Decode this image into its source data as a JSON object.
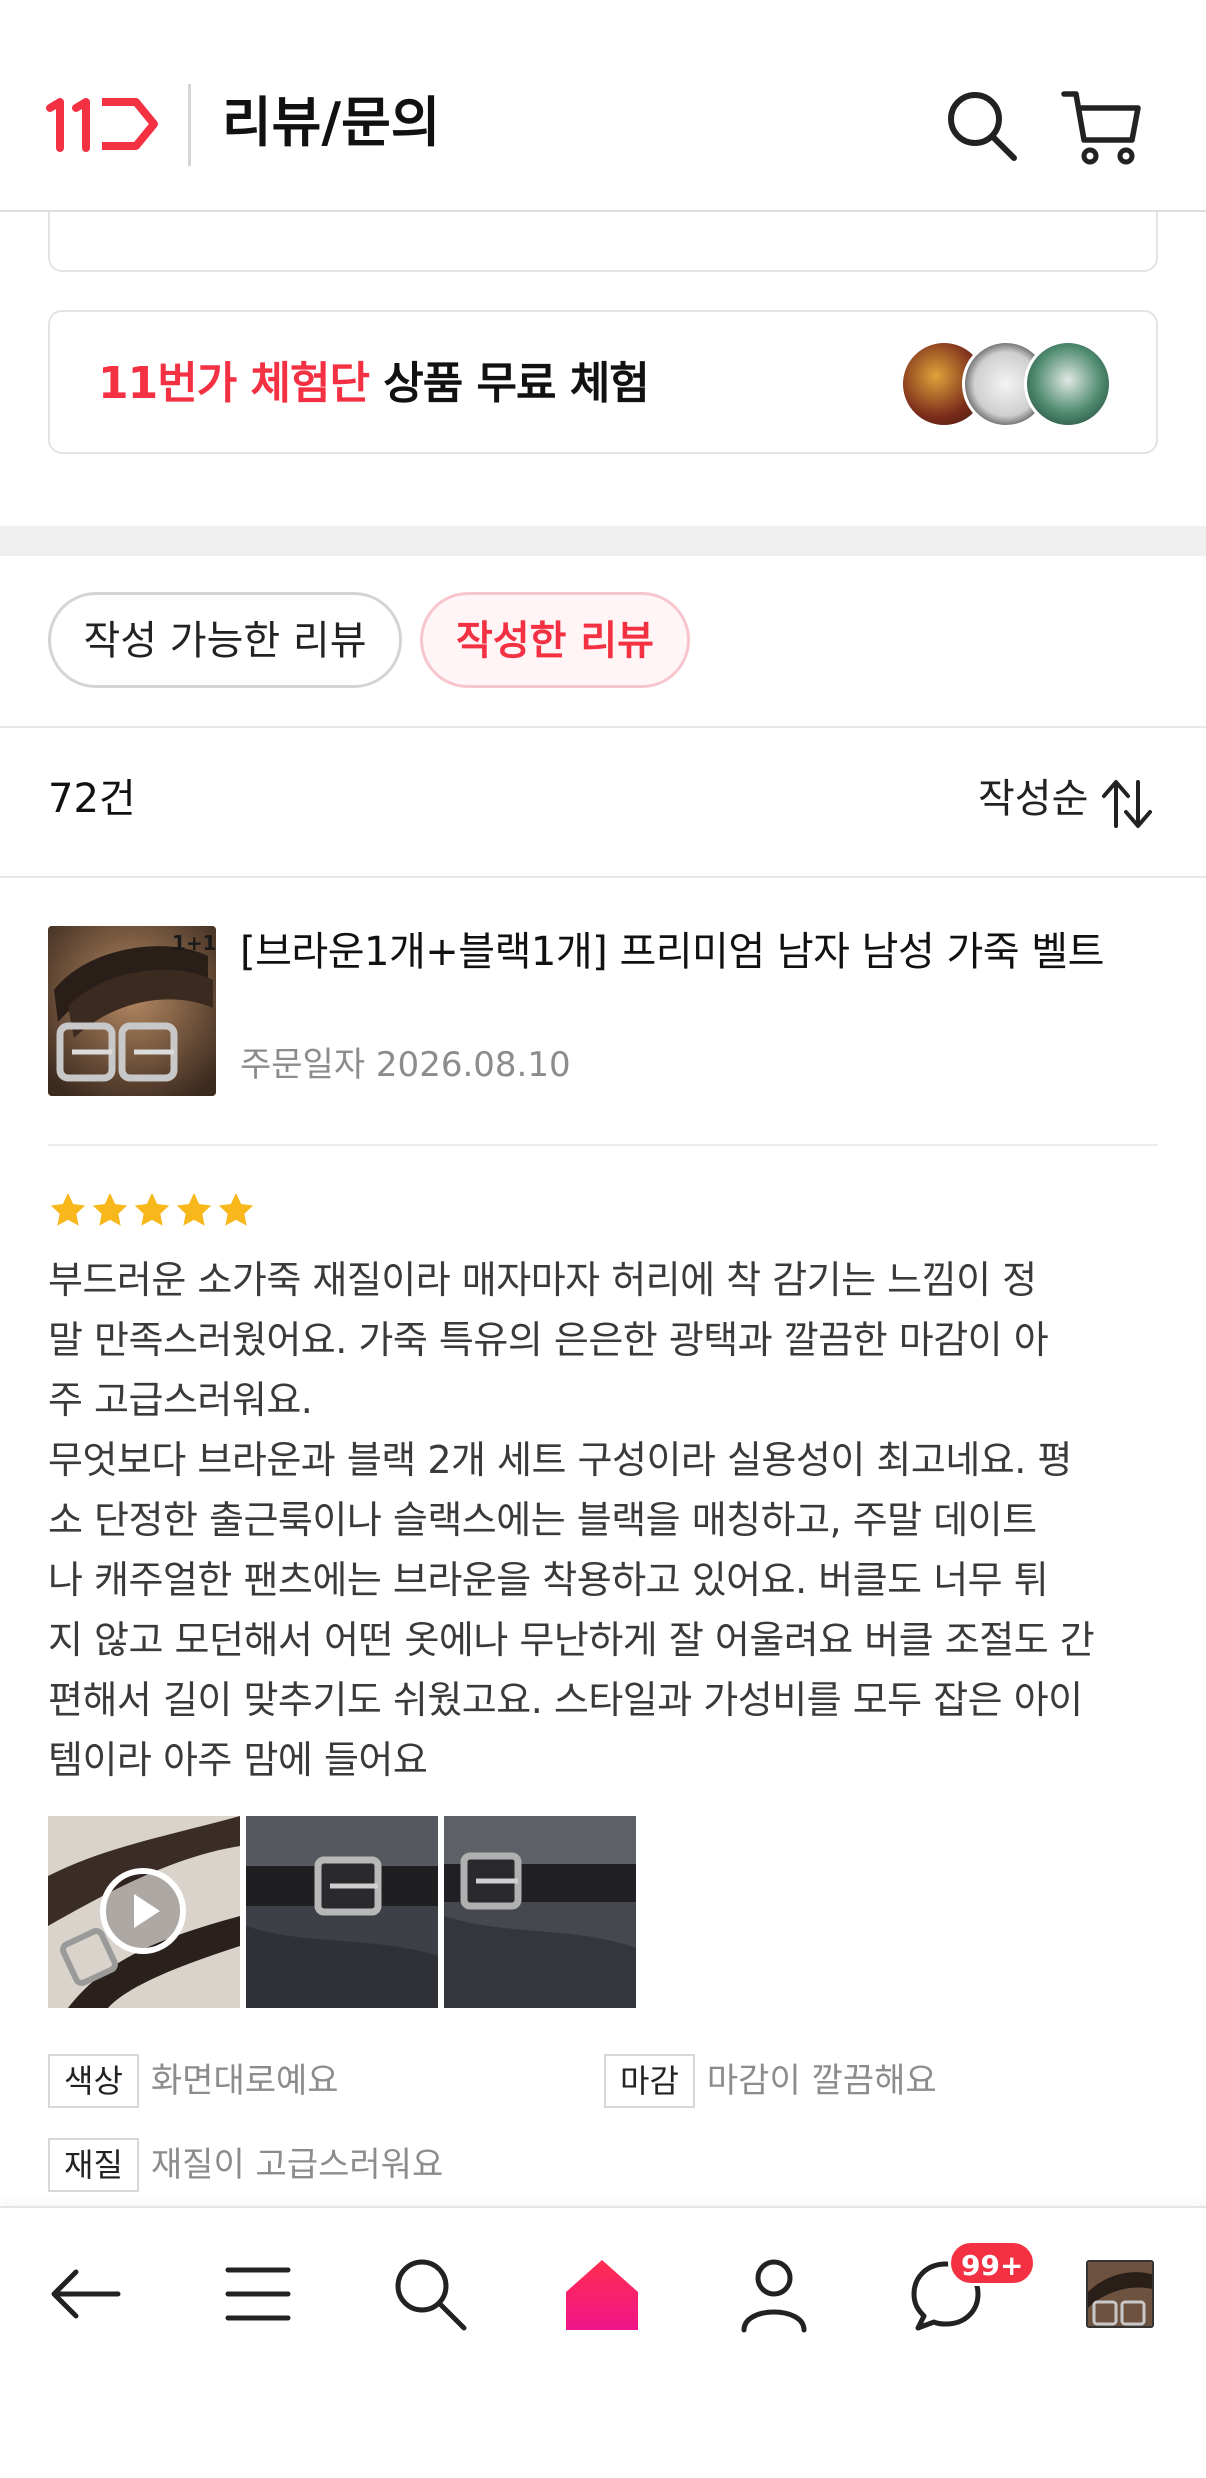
{
  "header": {
    "title": "리뷰/문의",
    "logo_text": "11",
    "brand_color": "#f43142",
    "search_icon": "search-icon",
    "cart_icon": "cart-icon"
  },
  "trial_banner": {
    "accent": "11번가 체험단",
    "text": " 상품 무료 체험"
  },
  "tabs": [
    {
      "label": "작성 가능한 리뷰",
      "active": false
    },
    {
      "label": "작성한 리뷰",
      "active": true
    }
  ],
  "list": {
    "count": "72건",
    "sort_label": "작성순"
  },
  "review": {
    "product_name": "[브라운1개+블랙1개] 프리미엄 남자 남성 가죽 벨트",
    "product_badge": "1+1",
    "order_date": "주문일자 2026.08.10",
    "rating": 5,
    "body": "부드러운 소가죽 재질이라 매자마자 허리에 착 감기는 느낌이 정\n말 만족스러웠어요. 가죽 특유의 은은한 광택과 깔끔한 마감이 아\n주 고급스러워요.\n무엇보다 브라운과 블랙 2개 세트 구성이라 실용성이 최고네요. 평\n소 단정한 출근룩이나 슬랙스에는 블랙을 매칭하고, 주말 데이트\n나 캐주얼한 팬츠에는 브라운을 착용하고 있어요. 버클도 너무 튀\n지 않고 모던해서 어떤 옷에나 무난하게 잘 어울려요 버클 조절도 간\n편해서 길이 맞추기도 쉬웠고요. 스타일과 가성비를 모두 잡은 아이\n템이라 아주 맘에 들어요",
    "attributes": [
      {
        "key": "색상",
        "value": "화면대로예요"
      },
      {
        "key": "마감",
        "value": "마감이 깔끔해요"
      },
      {
        "key": "재질",
        "value": "재질이 고급스러워요"
      }
    ]
  },
  "bottom_nav": {
    "items": [
      "back-arrow-icon",
      "menu-icon",
      "search-icon",
      "home-icon",
      "user-icon",
      "chat-icon",
      "recent-product-thumb"
    ],
    "chat_badge": "99+"
  }
}
